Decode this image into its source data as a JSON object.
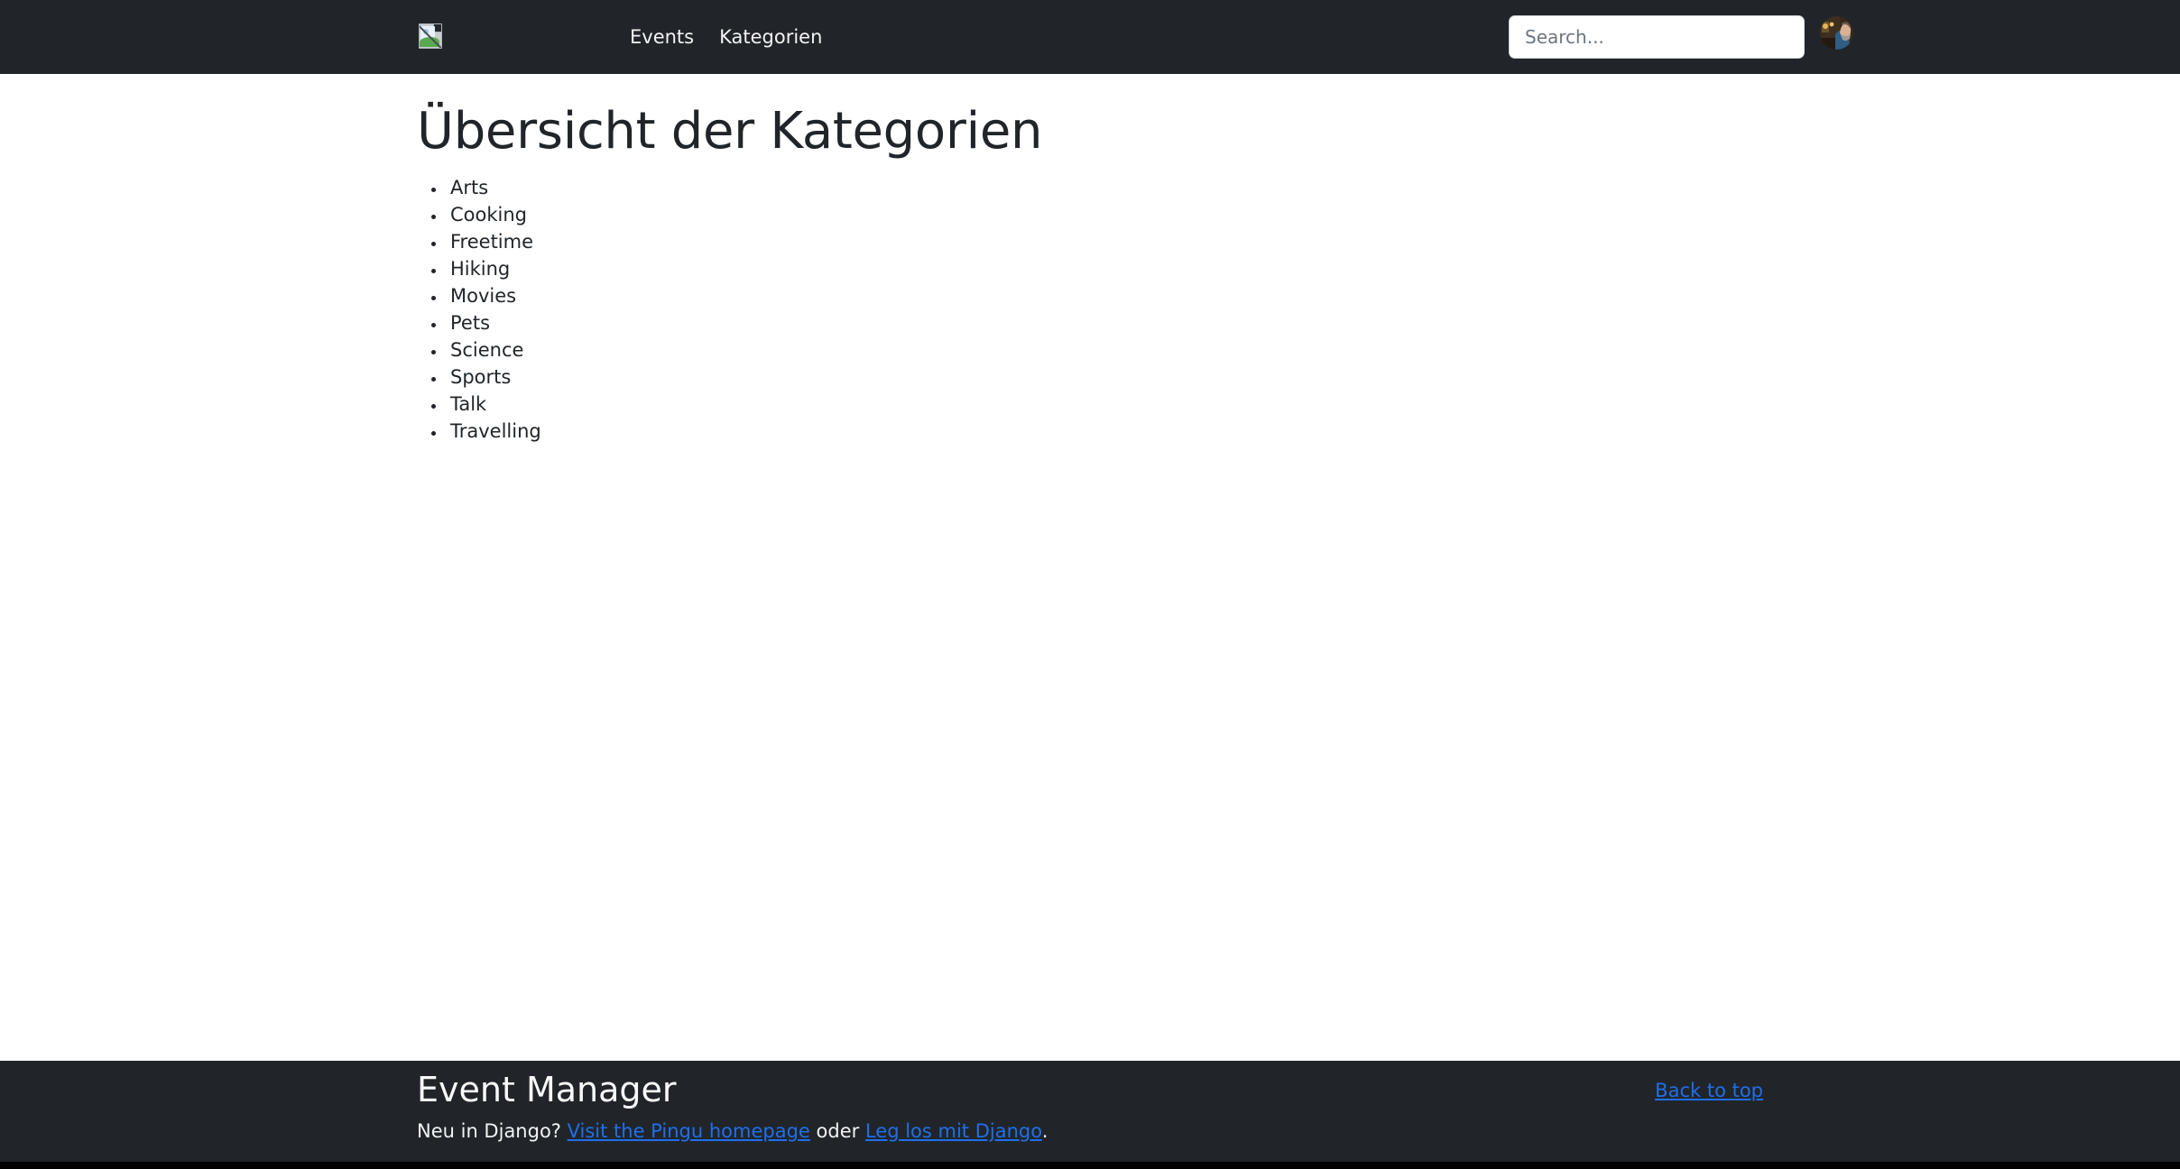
{
  "navbar": {
    "brand_logo_alt": "broken-image",
    "links": [
      {
        "label": "Events"
      },
      {
        "label": "Kategorien"
      }
    ],
    "search": {
      "placeholder": "Search...",
      "value": ""
    },
    "avatar_label": "user-avatar",
    "background_color": "#212529"
  },
  "main": {
    "title": "Übersicht der Kategorien",
    "categories": [
      {
        "label": "Arts"
      },
      {
        "label": "Cooking"
      },
      {
        "label": "Freetime"
      },
      {
        "label": "Hiking"
      },
      {
        "label": "Movies"
      },
      {
        "label": "Pets"
      },
      {
        "label": "Science"
      },
      {
        "label": "Sports"
      },
      {
        "label": "Talk"
      },
      {
        "label": "Travelling"
      }
    ]
  },
  "footer": {
    "title": "Event Manager",
    "intro_text": "Neu in Django? ",
    "link_pingu": "Visit the Pingu homepage",
    "conjunction": " oder ",
    "link_django": "Leg los mit Django",
    "period": ".",
    "back_to_top": "Back to top",
    "background_color": "#212529",
    "link_color": "#1f6feb"
  }
}
